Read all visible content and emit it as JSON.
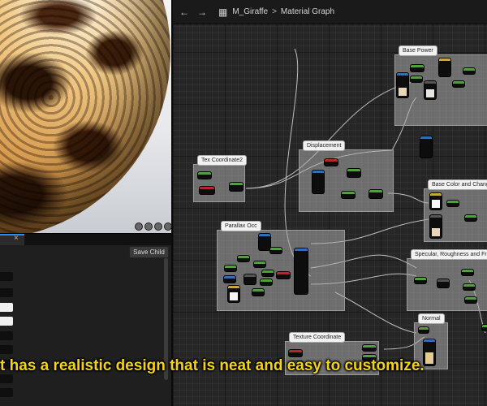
{
  "toolbar": {
    "back_icon": "back-arrow-icon",
    "forward_icon": "forward-arrow-icon",
    "graph_icon": "graph-icon",
    "asset_name": "M_Giraffe",
    "separator": ">",
    "graph_name": "Material Graph"
  },
  "details": {
    "close_glyph": "×",
    "save_child_label": "Save Child"
  },
  "comments": {
    "base_power": "Base Power",
    "displacement": "Displacement",
    "tex_coordinate2": "Tex Coordinate2",
    "base_color": "Base Color and Change",
    "parallax_occ": "Parallax Occ",
    "specular": "Specular, Roughness and Fre",
    "normal": "Normal",
    "texture_coordinate": "Texture Coordinate"
  },
  "caption": "t has a realistic design that is neat and easy to customize.",
  "colors": {
    "caption": "#f5d21a",
    "graph_bg": "#262626",
    "scalar_pin": "#4fa23a",
    "vector_pin": "#b5262c",
    "texture_pin": "#2f6fb5"
  }
}
